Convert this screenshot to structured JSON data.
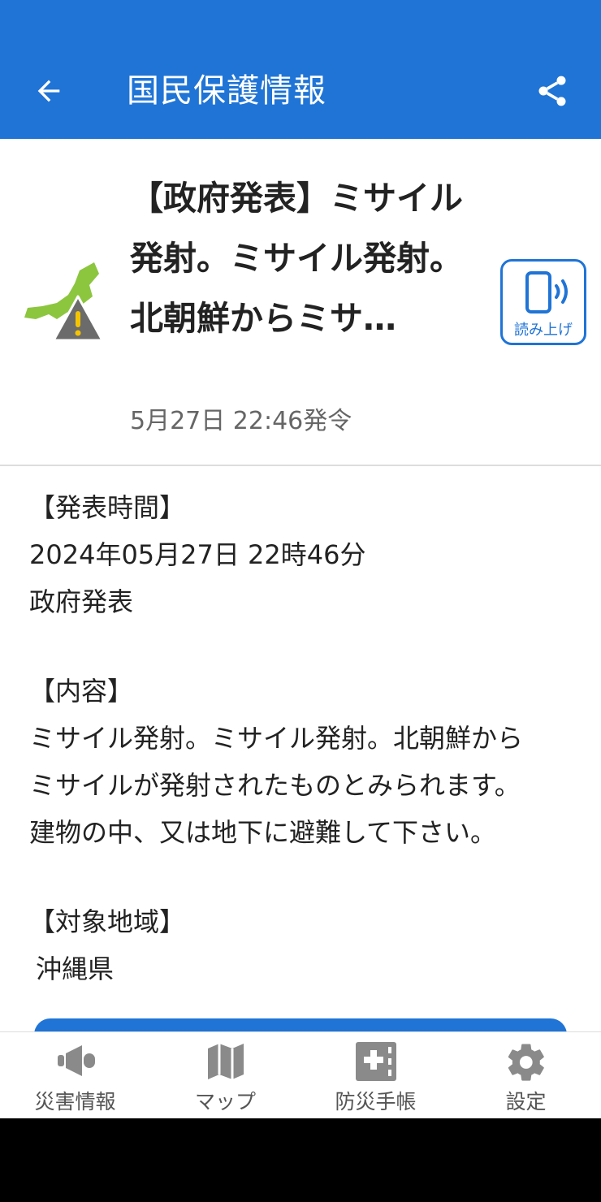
{
  "appbar": {
    "title": "国民保護情報",
    "back_icon": "arrow-left-icon",
    "share_icon": "share-icon"
  },
  "alert": {
    "icon": "japan-map-warning-icon",
    "title": "【政府発表】ミサイル発射。ミサイル発射。北朝鮮からミサ…",
    "issued": "5月27日 22:46発令",
    "read_aloud_label": "読み上げ"
  },
  "body": {
    "time_heading": "【発表時間】",
    "time_value": "2024年05月27日 22時46分",
    "source": "政府発表",
    "content_heading": "【内容】",
    "content_lines": [
      "ミサイル発射。ミサイル発射。北朝鮮から",
      "ミサイルが発射されたものとみられます。",
      "建物の中、又は地下に避難して下さい。"
    ],
    "area_heading": "【対象地域】",
    "area_value": "沖縄県"
  },
  "bottom_nav": [
    {
      "label": "災害情報",
      "icon": "megaphone-icon"
    },
    {
      "label": "マップ",
      "icon": "map-icon"
    },
    {
      "label": "防災手帳",
      "icon": "first-aid-book-icon"
    },
    {
      "label": "設定",
      "icon": "gear-icon"
    }
  ],
  "colors": {
    "primary": "#1f74d6",
    "map_green": "#8cc63f",
    "warning_yellow": "#f5c400",
    "nav_icon_gray": "#8a8a8a"
  }
}
